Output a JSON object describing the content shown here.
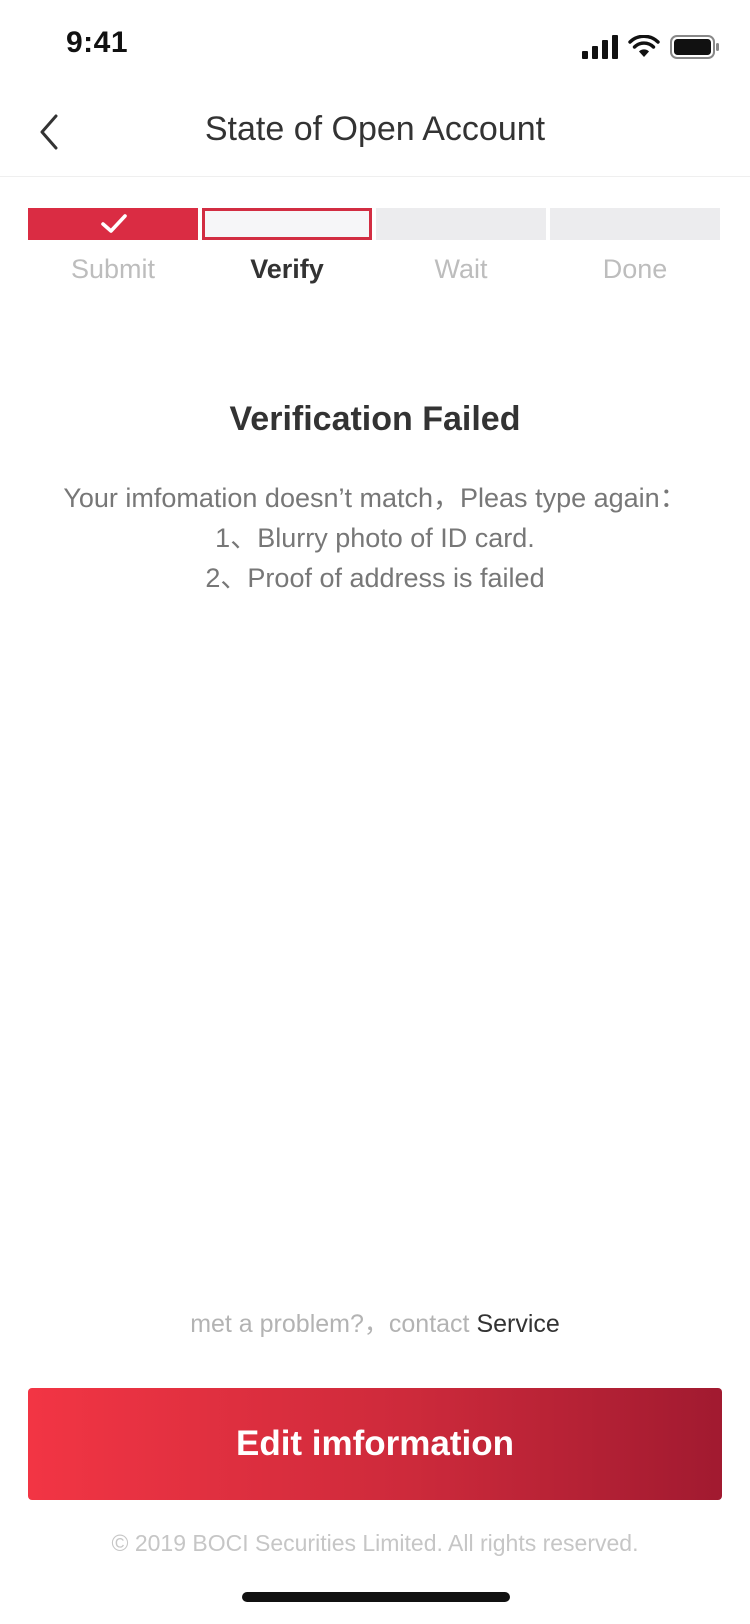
{
  "status_bar": {
    "time": "9:41",
    "icons": [
      "cellular-signal-icon",
      "wifi-icon",
      "battery-icon"
    ]
  },
  "nav": {
    "back_icon": "chevron-left-icon",
    "title": "State of Open Account"
  },
  "steps": [
    {
      "label": "Submit",
      "state": "done"
    },
    {
      "label": "Verify",
      "state": "current"
    },
    {
      "label": "Wait",
      "state": "pending"
    },
    {
      "label": "Done",
      "state": "pending"
    }
  ],
  "result": {
    "title": "Verification Failed",
    "message": "Your imfomation doesn’t match，Pleas type again：",
    "reasons": [
      "1、Blurry photo of ID card.",
      "2、Proof of address is failed"
    ]
  },
  "contact": {
    "prefix": "met a problem?，contact ",
    "link_label": "Service"
  },
  "primary_action": {
    "label": "Edit imformation"
  },
  "footer": {
    "copyright": "© 2019 BOCI Securities Limited. All rights reserved."
  },
  "colors": {
    "accent": "#da2c43",
    "accent_dark": "#a11a30",
    "pending_step": "#ececee"
  }
}
